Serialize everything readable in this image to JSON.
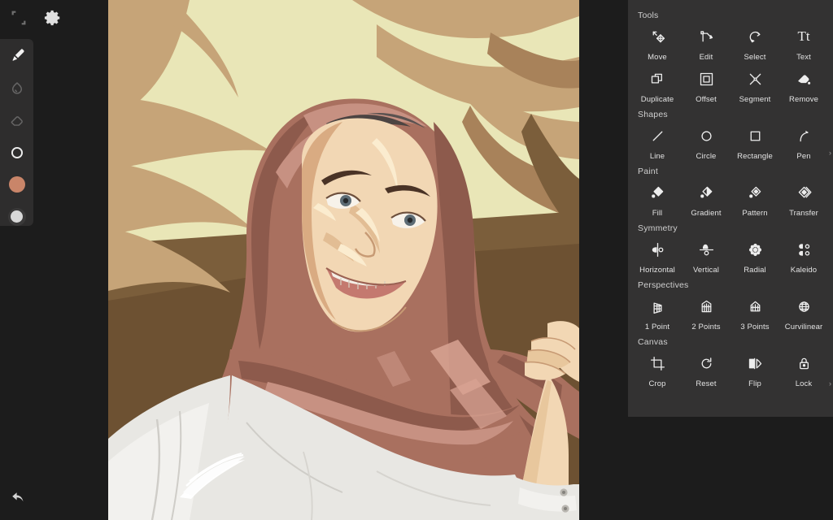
{
  "app": {
    "theme_bg": "#1c1c1c",
    "panel_bg": "#333232",
    "rail_bg": "#2e2d2d",
    "label_color": "#e2e2e2",
    "section_color": "#cfcfcf"
  },
  "topbar": {
    "items": [
      {
        "name": "transform-icon",
        "label": "Transform"
      },
      {
        "name": "gear-icon",
        "label": "Settings"
      }
    ]
  },
  "toolrail": {
    "items": [
      {
        "name": "brush-tool",
        "label": "Brush",
        "state": "active"
      },
      {
        "name": "smudge-tool",
        "label": "Smudge",
        "state": "dim"
      },
      {
        "name": "eraser-tool",
        "label": "Eraser",
        "state": "dim"
      },
      {
        "name": "size-tool",
        "label": "Brush Size",
        "state": "normal"
      },
      {
        "name": "color-swatch",
        "label": "Color",
        "color": "#c98569"
      },
      {
        "name": "secondary-color-swatch",
        "label": "Secondary Color",
        "color": "#d8d8d8"
      }
    ]
  },
  "undo": {
    "label": "Undo"
  },
  "canvas": {
    "title": "Artwork",
    "palette": {
      "bg_yellow": "#e9e6b7",
      "bg_tan": "#c6a478",
      "bg_brown": "#7b5e3b",
      "bg_brown_dark": "#6d5132",
      "hijab_mid": "#a9705f",
      "hijab_dark": "#8d5a4c",
      "hijab_light": "#c79182",
      "hijab_hi": "#d8a393",
      "skin": "#f2d7b4",
      "skin_hi": "#fbeccf",
      "skin_shadow": "#d9ab82",
      "garment": "#e8e7e3",
      "garment_shadow": "#cfcdc8",
      "hair": "#4c4442",
      "brow": "#4a3326",
      "lip": "#c4796f",
      "teeth": "#f4efe7",
      "eye": "#5c6b74",
      "line": "#8d6a54"
    }
  },
  "panel": {
    "sections": [
      {
        "name": "tools",
        "title": "Tools",
        "more": false,
        "items": [
          {
            "name": "move-tool",
            "label": "Move",
            "icon": "move-icon"
          },
          {
            "name": "edit-tool",
            "label": "Edit",
            "icon": "edit-node-icon"
          },
          {
            "name": "select-tool",
            "label": "Select",
            "icon": "select-lasso-icon"
          },
          {
            "name": "text-tool",
            "label": "Text",
            "icon": "text-icon"
          },
          {
            "name": "duplicate-tool",
            "label": "Duplicate",
            "icon": "duplicate-icon"
          },
          {
            "name": "offset-tool",
            "label": "Offset",
            "icon": "offset-icon"
          },
          {
            "name": "segment-tool",
            "label": "Segment",
            "icon": "segment-icon"
          },
          {
            "name": "remove-tool",
            "label": "Remove",
            "icon": "remove-eraser-icon"
          }
        ]
      },
      {
        "name": "shapes",
        "title": "Shapes",
        "more": true,
        "items": [
          {
            "name": "line-shape",
            "label": "Line",
            "icon": "line-icon"
          },
          {
            "name": "circle-shape",
            "label": "Circle",
            "icon": "circle-icon"
          },
          {
            "name": "rectangle-shape",
            "label": "Rectangle",
            "icon": "rectangle-icon"
          },
          {
            "name": "pen-shape",
            "label": "Pen",
            "icon": "pen-curve-icon"
          }
        ]
      },
      {
        "name": "paint",
        "title": "Paint",
        "more": false,
        "items": [
          {
            "name": "fill-paint",
            "label": "Fill",
            "icon": "fill-drop-icon"
          },
          {
            "name": "gradient-paint",
            "label": "Gradient",
            "icon": "gradient-drop-icon"
          },
          {
            "name": "pattern-paint",
            "label": "Pattern",
            "icon": "pattern-drop-icon"
          },
          {
            "name": "transfer-paint",
            "label": "Transfer",
            "icon": "transfer-diamond-icon"
          }
        ]
      },
      {
        "name": "symmetry",
        "title": "Symmetry",
        "more": false,
        "items": [
          {
            "name": "horizontal-symmetry",
            "label": "Horizontal",
            "icon": "symmetry-horizontal-icon"
          },
          {
            "name": "vertical-symmetry",
            "label": "Vertical",
            "icon": "symmetry-vertical-icon"
          },
          {
            "name": "radial-symmetry",
            "label": "Radial",
            "icon": "symmetry-radial-icon"
          },
          {
            "name": "kaleido-symmetry",
            "label": "Kaleido",
            "icon": "symmetry-kaleido-icon"
          }
        ]
      },
      {
        "name": "perspectives",
        "title": "Perspectives",
        "more": true,
        "items": [
          {
            "name": "one-point-perspective",
            "label": "1 Point",
            "icon": "perspective-1point-icon"
          },
          {
            "name": "two-point-perspective",
            "label": "2 Points",
            "icon": "perspective-2point-icon"
          },
          {
            "name": "three-point-perspective",
            "label": "3 Points",
            "icon": "perspective-3point-icon"
          },
          {
            "name": "curvilinear-perspective",
            "label": "Curvilinear",
            "icon": "perspective-curvilinear-icon"
          }
        ]
      },
      {
        "name": "canvas",
        "title": "Canvas",
        "more": false,
        "items": [
          {
            "name": "crop-canvas",
            "label": "Crop",
            "icon": "crop-icon"
          },
          {
            "name": "reset-canvas",
            "label": "Reset",
            "icon": "reset-rotate-icon"
          },
          {
            "name": "flip-canvas",
            "label": "Flip",
            "icon": "flip-icon"
          },
          {
            "name": "lock-canvas",
            "label": "Lock",
            "icon": "lock-icon"
          }
        ]
      }
    ],
    "more_glyph": "›"
  }
}
